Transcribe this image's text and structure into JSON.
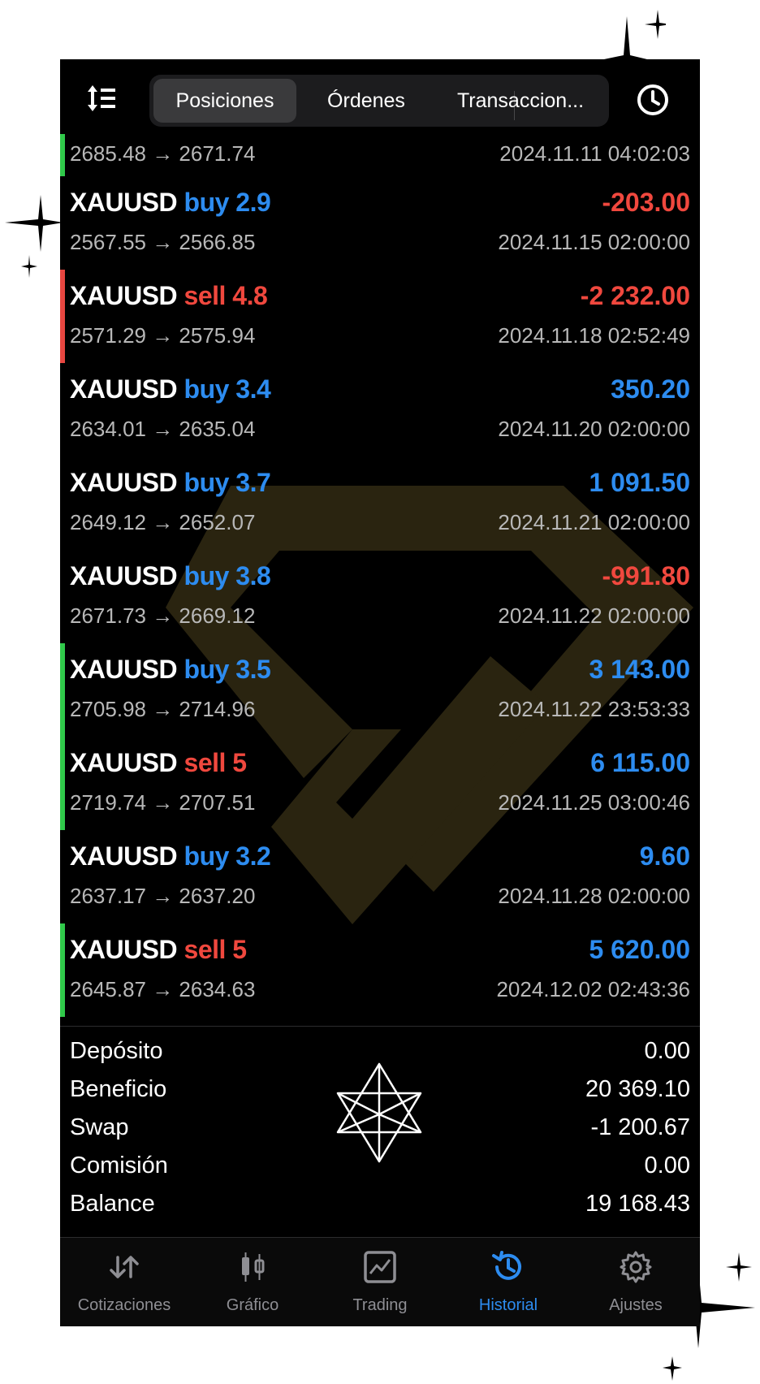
{
  "header": {
    "tabs": [
      "Posiciones",
      "Órdenes",
      "Transaccion..."
    ],
    "active_tab": 0
  },
  "partial_row": {
    "prices": "2685.48 → 2671.74",
    "time": "2024.11.11 04:02:03"
  },
  "trades": [
    {
      "symbol": "XAUUSD",
      "side": "buy",
      "side_label": "buy 2.9",
      "profit": "-203.00",
      "prices": "2567.55 → 2566.85",
      "time": "2024.11.15 02:00:00",
      "marker": "none"
    },
    {
      "symbol": "XAUUSD",
      "side": "sell",
      "side_label": "sell 4.8",
      "profit": "-2 232.00",
      "prices": "2571.29 → 2575.94",
      "time": "2024.11.18 02:52:49",
      "marker": "red"
    },
    {
      "symbol": "XAUUSD",
      "side": "buy",
      "side_label": "buy 3.4",
      "profit": "350.20",
      "prices": "2634.01 → 2635.04",
      "time": "2024.11.20 02:00:00",
      "marker": "none"
    },
    {
      "symbol": "XAUUSD",
      "side": "buy",
      "side_label": "buy 3.7",
      "profit": "1 091.50",
      "prices": "2649.12 → 2652.07",
      "time": "2024.11.21 02:00:00",
      "marker": "none"
    },
    {
      "symbol": "XAUUSD",
      "side": "buy",
      "side_label": "buy 3.8",
      "profit": "-991.80",
      "prices": "2671.73 → 2669.12",
      "time": "2024.11.22 02:00:00",
      "marker": "none"
    },
    {
      "symbol": "XAUUSD",
      "side": "buy",
      "side_label": "buy 3.5",
      "profit": "3 143.00",
      "prices": "2705.98 → 2714.96",
      "time": "2024.11.22 23:53:33",
      "marker": "green"
    },
    {
      "symbol": "XAUUSD",
      "side": "sell",
      "side_label": "sell 5",
      "profit": "6 115.00",
      "prices": "2719.74 → 2707.51",
      "time": "2024.11.25 03:00:46",
      "marker": "green"
    },
    {
      "symbol": "XAUUSD",
      "side": "buy",
      "side_label": "buy 3.2",
      "profit": "9.60",
      "prices": "2637.17 → 2637.20",
      "time": "2024.11.28 02:00:00",
      "marker": "none"
    },
    {
      "symbol": "XAUUSD",
      "side": "sell",
      "side_label": "sell 5",
      "profit": "5 620.00",
      "prices": "2645.87 → 2634.63",
      "time": "2024.12.02 02:43:36",
      "marker": "green"
    }
  ],
  "summary": [
    {
      "label": "Depósito",
      "value": "0.00"
    },
    {
      "label": "Beneficio",
      "value": "20 369.10"
    },
    {
      "label": "Swap",
      "value": "-1 200.67"
    },
    {
      "label": "Comisión",
      "value": "0.00"
    },
    {
      "label": "Balance",
      "value": "19 168.43"
    }
  ],
  "tabbar": [
    {
      "label": "Cotizaciones",
      "icon": "quotes-icon"
    },
    {
      "label": "Gráfico",
      "icon": "chart-icon"
    },
    {
      "label": "Trading",
      "icon": "trading-icon"
    },
    {
      "label": "Historial",
      "icon": "history-icon"
    },
    {
      "label": "Ajustes",
      "icon": "settings-icon"
    }
  ],
  "active_nav": 3,
  "colors": {
    "buy": "#2d8cf0",
    "sell": "#f0483e",
    "profit_positive": "#2d8cf0",
    "profit_negative": "#f0483e",
    "marker_green": "#30c94a",
    "marker_red": "#e74640",
    "watermark": "#2a2410"
  }
}
